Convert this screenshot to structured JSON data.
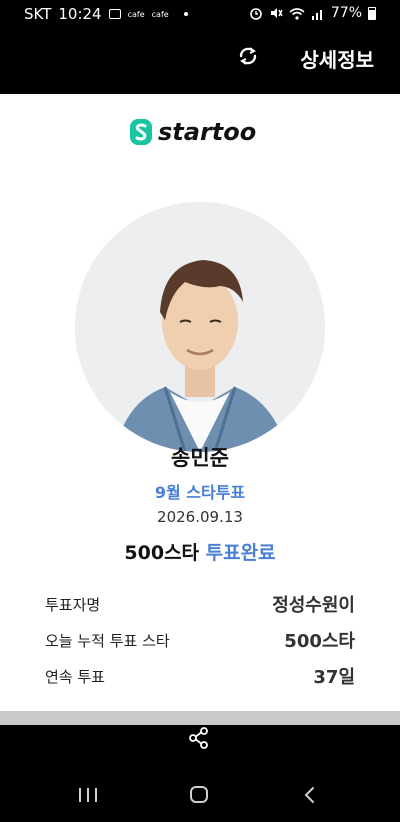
{
  "status_bar": {
    "carrier": "SKT",
    "time": "10:24",
    "notif_1": "cafe",
    "notif_2": "cafe",
    "battery": "77%"
  },
  "app_bar": {
    "detail_label": "상세정보",
    "refresh_icon": "refresh-icon"
  },
  "card": {
    "logo_text": "startoo",
    "name": "송민준",
    "subtitle": "9월 스타투표",
    "date": "2026.09.13",
    "votes_amount": "500스타",
    "votes_status": "투표완료",
    "rows": [
      {
        "label": "투표자명",
        "value": "정성수원이"
      },
      {
        "label": "오늘 누적 투표 스타",
        "value": "500스타"
      },
      {
        "label": "연속 투표",
        "value": "37일"
      }
    ]
  },
  "colors": {
    "accent": "#4a7fd6",
    "logo": "#19c4a2"
  }
}
